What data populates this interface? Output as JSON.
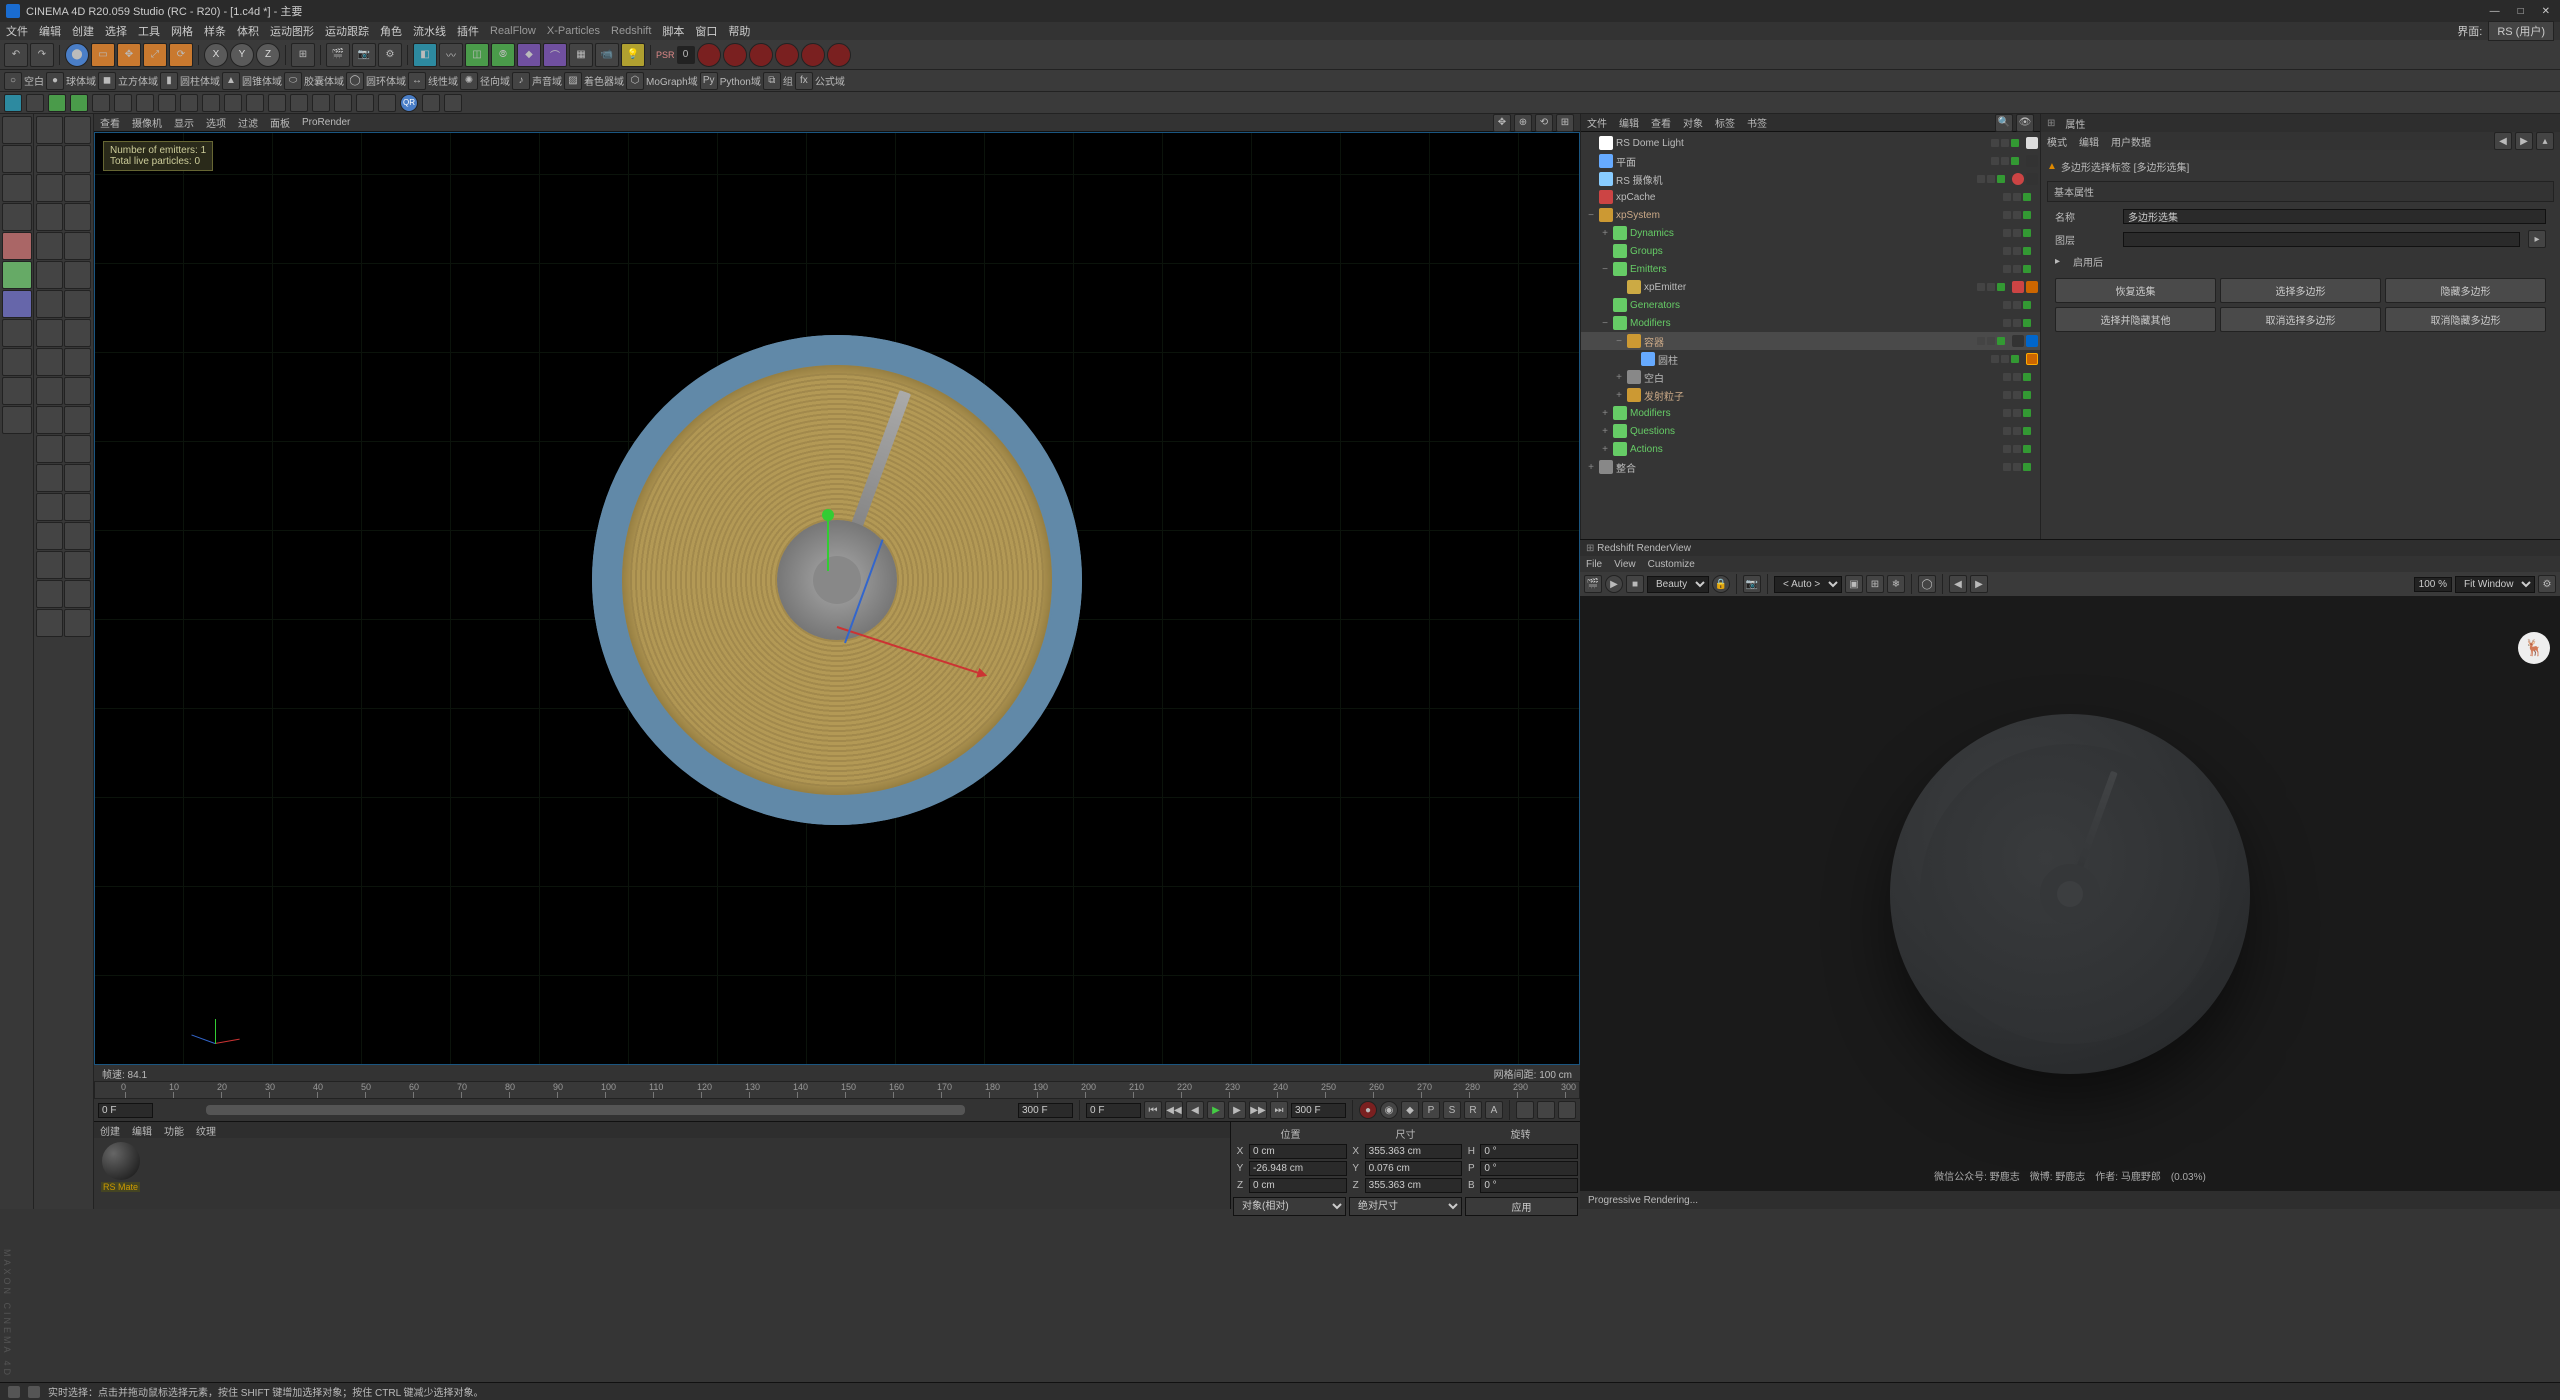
{
  "window": {
    "title": "CINEMA 4D R20.059 Studio (RC - R20) - [1.c4d *] - 主要"
  },
  "main_menu": [
    "文件",
    "编辑",
    "创建",
    "选择",
    "工具",
    "网格",
    "样条",
    "体积",
    "运动图形",
    "运动跟踪",
    "角色",
    "流水线",
    "插件",
    "RealFlow",
    "X-Particles",
    "Redshift",
    "脚本",
    "窗口",
    "帮助"
  ],
  "main_menu_right": {
    "layout_label": "界面:",
    "layout_name": "RS (用户)"
  },
  "primitive_bar": [
    "空白",
    "球体域",
    "立方体域",
    "圆柱体域",
    "圆锥体域",
    "胶囊体域",
    "圆环体域",
    "线性域",
    "径向域",
    "声音域",
    "着色器域",
    "MoGraph域",
    "Python域",
    "组",
    "公式域"
  ],
  "viewport_menu": [
    "查看",
    "摄像机",
    "显示",
    "选项",
    "过滤",
    "面板",
    "ProRender"
  ],
  "viewport_status": {
    "fps": "帧速: 84.1",
    "grid": "网格间距: 100 cm"
  },
  "tooltip": {
    "line1": "Number of emitters: 1",
    "line2": "Total live particles: 0"
  },
  "object_panel_tabs": [
    "文件",
    "编辑",
    "查看",
    "对象",
    "标签",
    "书签"
  ],
  "objects": [
    {
      "depth": 0,
      "name": "RS Dome Light",
      "icon": "#fff",
      "class": ""
    },
    {
      "depth": 0,
      "name": "平面",
      "icon": "#6af",
      "class": ""
    },
    {
      "depth": 0,
      "name": "RS 摄像机",
      "icon": "#8cf",
      "class": ""
    },
    {
      "depth": 0,
      "name": "xpCache",
      "icon": "#c44",
      "class": ""
    },
    {
      "depth": 0,
      "name": "xpSystem",
      "icon": "#c93",
      "class": "orange",
      "expand": "−"
    },
    {
      "depth": 1,
      "name": "Dynamics",
      "icon": "#6c6",
      "class": "green",
      "expand": "+"
    },
    {
      "depth": 1,
      "name": "Groups",
      "icon": "#6c6",
      "class": "green"
    },
    {
      "depth": 1,
      "name": "Emitters",
      "icon": "#6c6",
      "class": "green",
      "expand": "−"
    },
    {
      "depth": 2,
      "name": "xpEmitter",
      "icon": "#ca4",
      "class": ""
    },
    {
      "depth": 1,
      "name": "Generators",
      "icon": "#6c6",
      "class": "green"
    },
    {
      "depth": 1,
      "name": "Modifiers",
      "icon": "#6c6",
      "class": "green",
      "expand": "−"
    },
    {
      "depth": 2,
      "name": "容器",
      "icon": "#c93",
      "class": "orange",
      "expand": "−",
      "selected": true
    },
    {
      "depth": 3,
      "name": "圆柱",
      "icon": "#6af",
      "class": ""
    },
    {
      "depth": 2,
      "name": "空白",
      "icon": "#888",
      "class": "",
      "expand": "+"
    },
    {
      "depth": 2,
      "name": "发射粒子",
      "icon": "#c93",
      "class": "orange",
      "expand": "+"
    },
    {
      "depth": 1,
      "name": "Modifiers",
      "icon": "#6c6",
      "class": "green",
      "expand": "+"
    },
    {
      "depth": 1,
      "name": "Questions",
      "icon": "#6c6",
      "class": "green",
      "expand": "+"
    },
    {
      "depth": 1,
      "name": "Actions",
      "icon": "#6c6",
      "class": "green",
      "expand": "+"
    },
    {
      "depth": 0,
      "name": "整合",
      "icon": "#888",
      "class": "",
      "expand": "+"
    }
  ],
  "attributes": {
    "panel_label": "属性",
    "tabs": [
      "模式",
      "编辑",
      "用户数据"
    ],
    "object_title": "多边形选择标签 [多边形选集]",
    "section_title": "基本属性",
    "name_label": "名称",
    "name_value": "多边形选集",
    "layer_label": "图层",
    "enable_label": "启用后",
    "buttons": [
      "恢复选集",
      "选择多边形",
      "隐藏多边形",
      "选择并隐藏其他",
      "取消选择多边形",
      "取消隐藏多边形"
    ]
  },
  "render": {
    "title": "Redshift RenderView",
    "menu": [
      "File",
      "View",
      "Customize"
    ],
    "beauty": "Beauty",
    "auto": "< Auto >",
    "zoom": "100 %",
    "fit": "Fit Window",
    "credit": "微信公众号: 野鹿志　微博: 野鹿志　作者: 马鹿野郎　(0.03%)",
    "status": "Progressive Rendering..."
  },
  "timeline": {
    "start": "0 F",
    "end": "300 F",
    "current": "0 F",
    "range_end": "300 F",
    "ticks": [
      0,
      10,
      20,
      30,
      40,
      50,
      60,
      70,
      80,
      90,
      100,
      110,
      120,
      130,
      140,
      150,
      160,
      170,
      180,
      190,
      200,
      210,
      220,
      230,
      240,
      250,
      260,
      270,
      280,
      290,
      300
    ]
  },
  "materials": {
    "tabs": [
      "创建",
      "编辑",
      "功能",
      "纹理"
    ],
    "items": [
      {
        "name": "RS Mate"
      }
    ]
  },
  "coords": {
    "headers": [
      "位置",
      "尺寸",
      "旋转"
    ],
    "rows": [
      {
        "k1": "X",
        "v1": "0 cm",
        "k2": "X",
        "v2": "355.363 cm",
        "k3": "H",
        "v3": "0 °"
      },
      {
        "k1": "Y",
        "v1": "-26.948 cm",
        "k2": "Y",
        "v2": "0.076 cm",
        "k3": "P",
        "v3": "0 °"
      },
      {
        "k1": "Z",
        "v1": "0 cm",
        "k2": "Z",
        "v2": "355.363 cm",
        "k3": "B",
        "v3": "0 °"
      }
    ],
    "mode": "对象(相对)",
    "world": "绝对尺寸",
    "apply": "应用"
  },
  "statusbar": "实时选择：点击并拖动鼠标选择元素，按住 SHIFT 键增加选择对象；按住 CTRL 键减少选择对象。",
  "psr": "PSR",
  "psr_val": "0"
}
